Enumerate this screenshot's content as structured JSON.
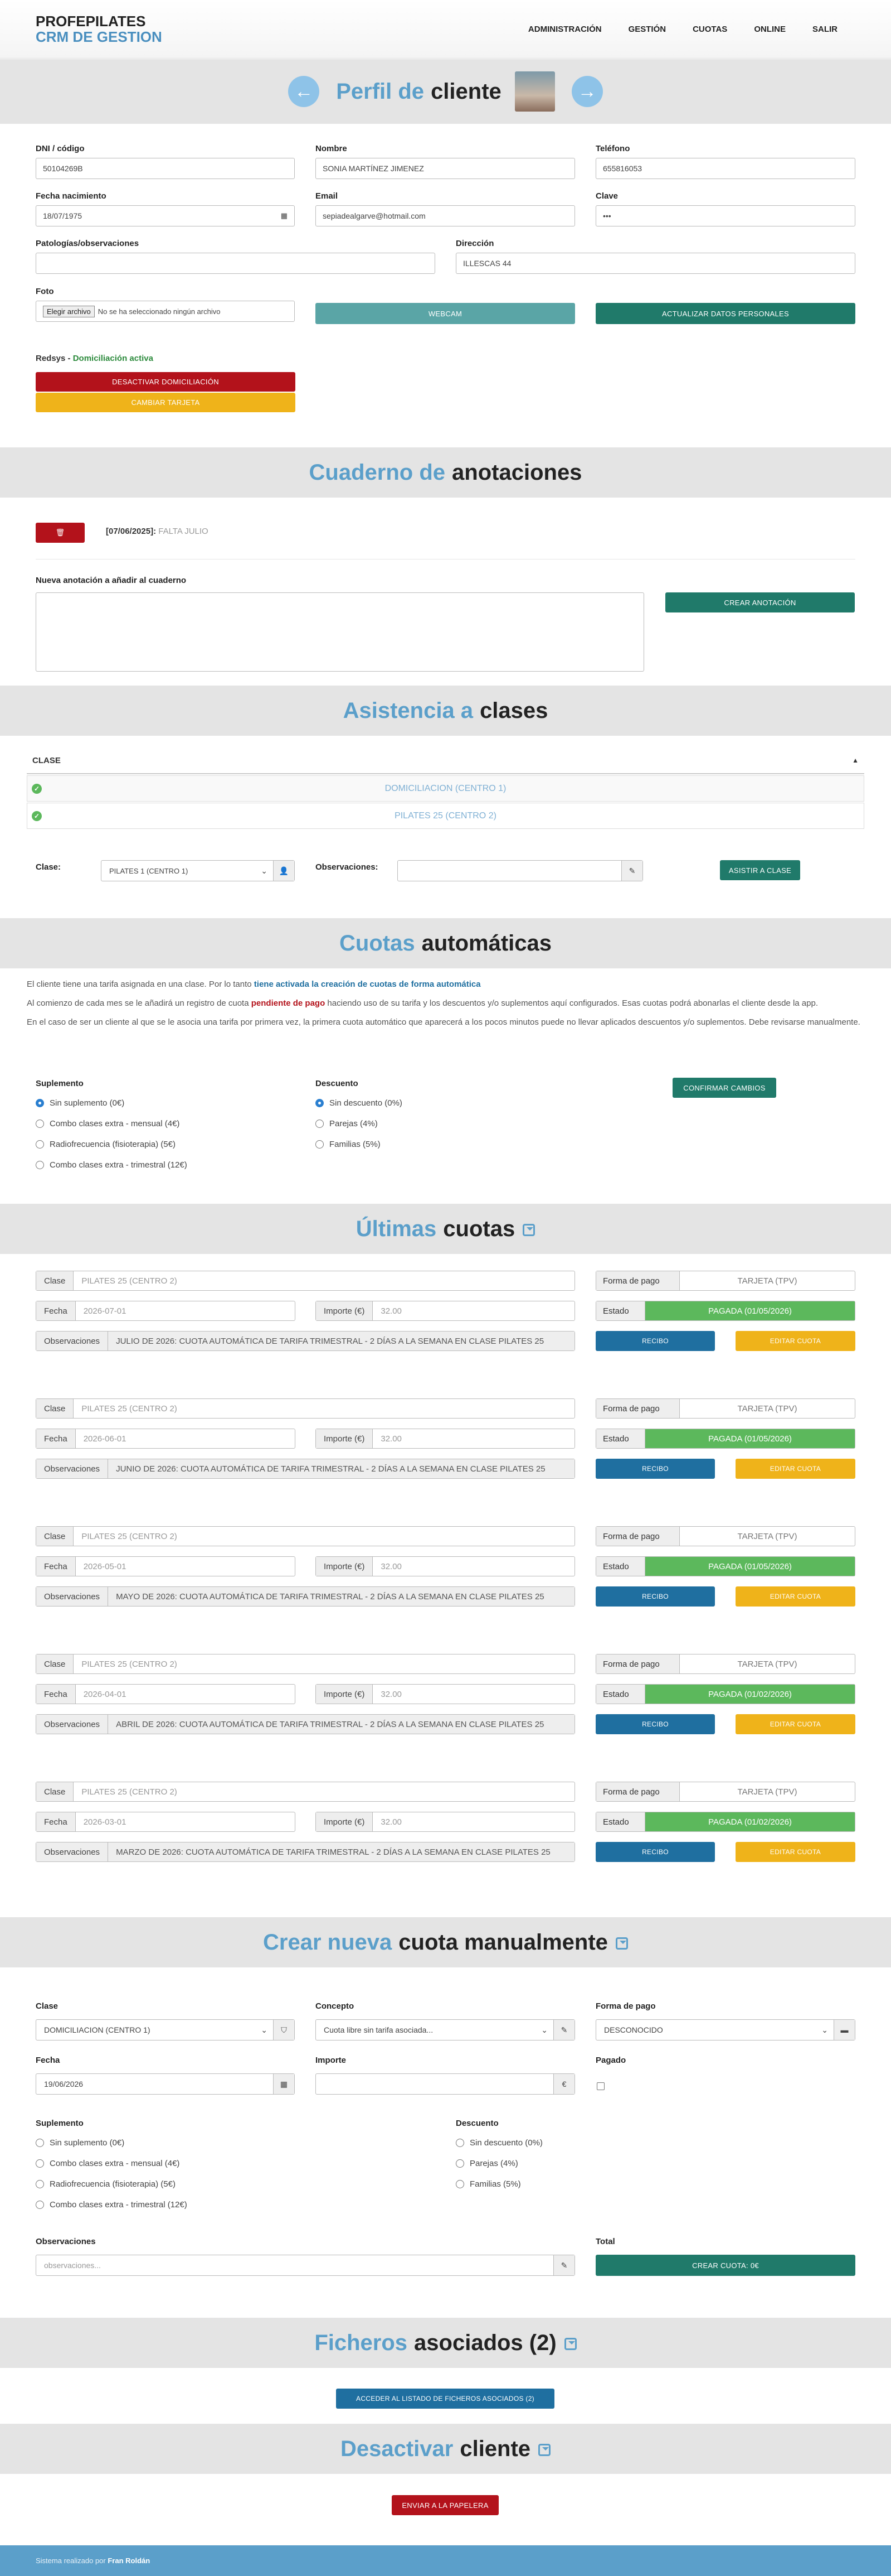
{
  "brand": {
    "line1": "PROFEPILATES",
    "line2": "CRM DE GESTION"
  },
  "nav": [
    "ADMINISTRACIÓN",
    "GESTIÓN",
    "CUOTAS",
    "ONLINE",
    "SALIR"
  ],
  "profile": {
    "title_accent": "Perfil de",
    "title_rest": "cliente",
    "dni_label": "DNI / código",
    "dni": "50104269B",
    "nombre_label": "Nombre",
    "nombre": "SONIA MARTÍNEZ JIMENEZ",
    "tel_label": "Teléfono",
    "tel": "655816053",
    "fnac_label": "Fecha nacimiento",
    "fnac": "18/07/1975",
    "email_label": "Email",
    "email": "sepiadealgarve@hotmail.com",
    "clave_label": "Clave",
    "clave": "•••",
    "pato_label": "Patologías/observaciones",
    "pato": "",
    "dir_label": "Dirección",
    "dir": "ILLESCAS 44",
    "foto_label": "Foto",
    "file_btn": "Elegir archivo",
    "file_text": "No se ha seleccionado ningún archivo",
    "webcam": "WEBCAM",
    "update": "ACTUALIZAR DATOS PERSONALES",
    "redsys": "Redsys -",
    "redsys_status": "Domiciliación activa",
    "deactivate": "DESACTIVAR DOMICILIACIÓN",
    "card": "CAMBIAR TARJETA"
  },
  "notes": {
    "title_accent": "Cuaderno de",
    "title_rest": "anotaciones",
    "entry_date": "[07/06/2025]:",
    "entry_text": "FALTA JULIO",
    "new_label": "Nueva anotación a añadir al cuaderno",
    "create": "CREAR ANOTACIÓN"
  },
  "attendance": {
    "title_accent": "Asistencia a",
    "title_rest": "clases",
    "col": "CLASE",
    "rows": [
      "DOMICILIACION (CENTRO 1)",
      "PILATES 25 (CENTRO 2)"
    ],
    "clase_label": "Clase:",
    "clase_value": "PILATES 1 (CENTRO 1)",
    "obs_label": "Observaciones:",
    "submit": "ASISTIR A CLASE"
  },
  "auto": {
    "title_accent": "Cuotas",
    "title_rest": "automáticas",
    "p1a": "El cliente tiene una tarifa asignada en una clase. Por lo tanto",
    "p1b": "tiene activada la creación de cuotas de forma automática",
    "p2a": "Al comienzo de cada mes se le añadirá un registro de cuota",
    "p2b": "pendiente de pago",
    "p2c": "haciendo uso de su tarifa y los descuentos y/o suplementos aquí configurados. Esas cuotas podrá abonarlas el cliente desde la app.",
    "p3": "En el caso de ser un cliente al que se le asocia una tarifa por primera vez, la primera cuota automático que aparecerá a los pocos minutos puede no llevar aplicados descuentos y/o suplementos. Debe revisarse manualmente.",
    "sup_label": "Suplemento",
    "sups": [
      "Sin suplemento (0€)",
      "Combo clases extra - mensual (4€)",
      "Radiofrecuencia (fisioterapia) (5€)",
      "Combo clases extra - trimestral (12€)"
    ],
    "desc_label": "Descuento",
    "descs": [
      "Sin descuento (0%)",
      "Parejas (4%)",
      "Familias (5%)"
    ],
    "confirm": "CONFIRMAR CAMBIOS"
  },
  "last": {
    "title_accent": "Últimas",
    "title_rest": "cuotas",
    "k_clase": "Clase",
    "k_fecha": "Fecha",
    "k_importe": "Importe (€)",
    "k_obs": "Observaciones",
    "k_forma": "Forma de pago",
    "k_estado": "Estado",
    "recibo": "RECIBO",
    "editar": "EDITAR CUOTA",
    "items": [
      {
        "clase": "PILATES 25 (CENTRO 2)",
        "fecha": "2026-07-01",
        "importe": "32.00",
        "obs": "JULIO DE 2026: CUOTA AUTOMÁTICA DE TARIFA TRIMESTRAL - 2 DÍAS A LA SEMANA EN CLASE PILATES 25",
        "forma": "TARJETA (TPV)",
        "estado": "PAGADA (01/05/2026)"
      },
      {
        "clase": "PILATES 25 (CENTRO 2)",
        "fecha": "2026-06-01",
        "importe": "32.00",
        "obs": "JUNIO DE 2026: CUOTA AUTOMÁTICA DE TARIFA TRIMESTRAL - 2 DÍAS A LA SEMANA EN CLASE PILATES 25",
        "forma": "TARJETA (TPV)",
        "estado": "PAGADA (01/05/2026)"
      },
      {
        "clase": "PILATES 25 (CENTRO 2)",
        "fecha": "2026-05-01",
        "importe": "32.00",
        "obs": "MAYO DE 2026: CUOTA AUTOMÁTICA DE TARIFA TRIMESTRAL - 2 DÍAS A LA SEMANA EN CLASE PILATES 25",
        "forma": "TARJETA (TPV)",
        "estado": "PAGADA (01/05/2026)"
      },
      {
        "clase": "PILATES 25 (CENTRO 2)",
        "fecha": "2026-04-01",
        "importe": "32.00",
        "obs": "ABRIL DE 2026: CUOTA AUTOMÁTICA DE TARIFA TRIMESTRAL - 2 DÍAS A LA SEMANA EN CLASE PILATES 25",
        "forma": "TARJETA (TPV)",
        "estado": "PAGADA (01/02/2026)"
      },
      {
        "clase": "PILATES 25 (CENTRO 2)",
        "fecha": "2026-03-01",
        "importe": "32.00",
        "obs": "MARZO DE 2026: CUOTA AUTOMÁTICA DE TARIFA TRIMESTRAL - 2 DÍAS A LA SEMANA EN CLASE PILATES 25",
        "forma": "TARJETA (TPV)",
        "estado": "PAGADA (01/02/2026)"
      }
    ]
  },
  "manual": {
    "title_accent": "Crear nueva",
    "title_rest": "cuota manualmente",
    "clase_label": "Clase",
    "clase": "DOMICILIACION (CENTRO 1)",
    "concepto_label": "Concepto",
    "concepto": "Cuota libre sin tarifa asociada...",
    "forma_label": "Forma de pago",
    "forma": "DESCONOCIDO",
    "fecha_label": "Fecha",
    "fecha": "19/06/2026",
    "importe_label": "Importe",
    "importe": "",
    "euro": "€",
    "pagado_label": "Pagado",
    "sup_label": "Suplemento",
    "desc_label": "Descuento",
    "obs_label": "Observaciones",
    "obs_placeholder": "observaciones...",
    "total_label": "Total",
    "create": "CREAR CUOTA: 0€"
  },
  "files": {
    "title_accent": "Ficheros",
    "title_rest": "asociados (2)",
    "button": "ACCEDER AL LISTADO DE FICHEROS ASOCIADOS (2)"
  },
  "deact": {
    "title_accent": "Desactivar",
    "title_rest": "cliente",
    "button": "ENVIAR A LA PAPELERA"
  },
  "footer": {
    "text": "Sistema realizado por",
    "author": "Fran Roldán"
  },
  "colors": {
    "accent": "#5b9fca",
    "green": "#207a6a",
    "red": "#b3121b",
    "yellow": "#efb31a",
    "paid": "#5cb85c"
  }
}
